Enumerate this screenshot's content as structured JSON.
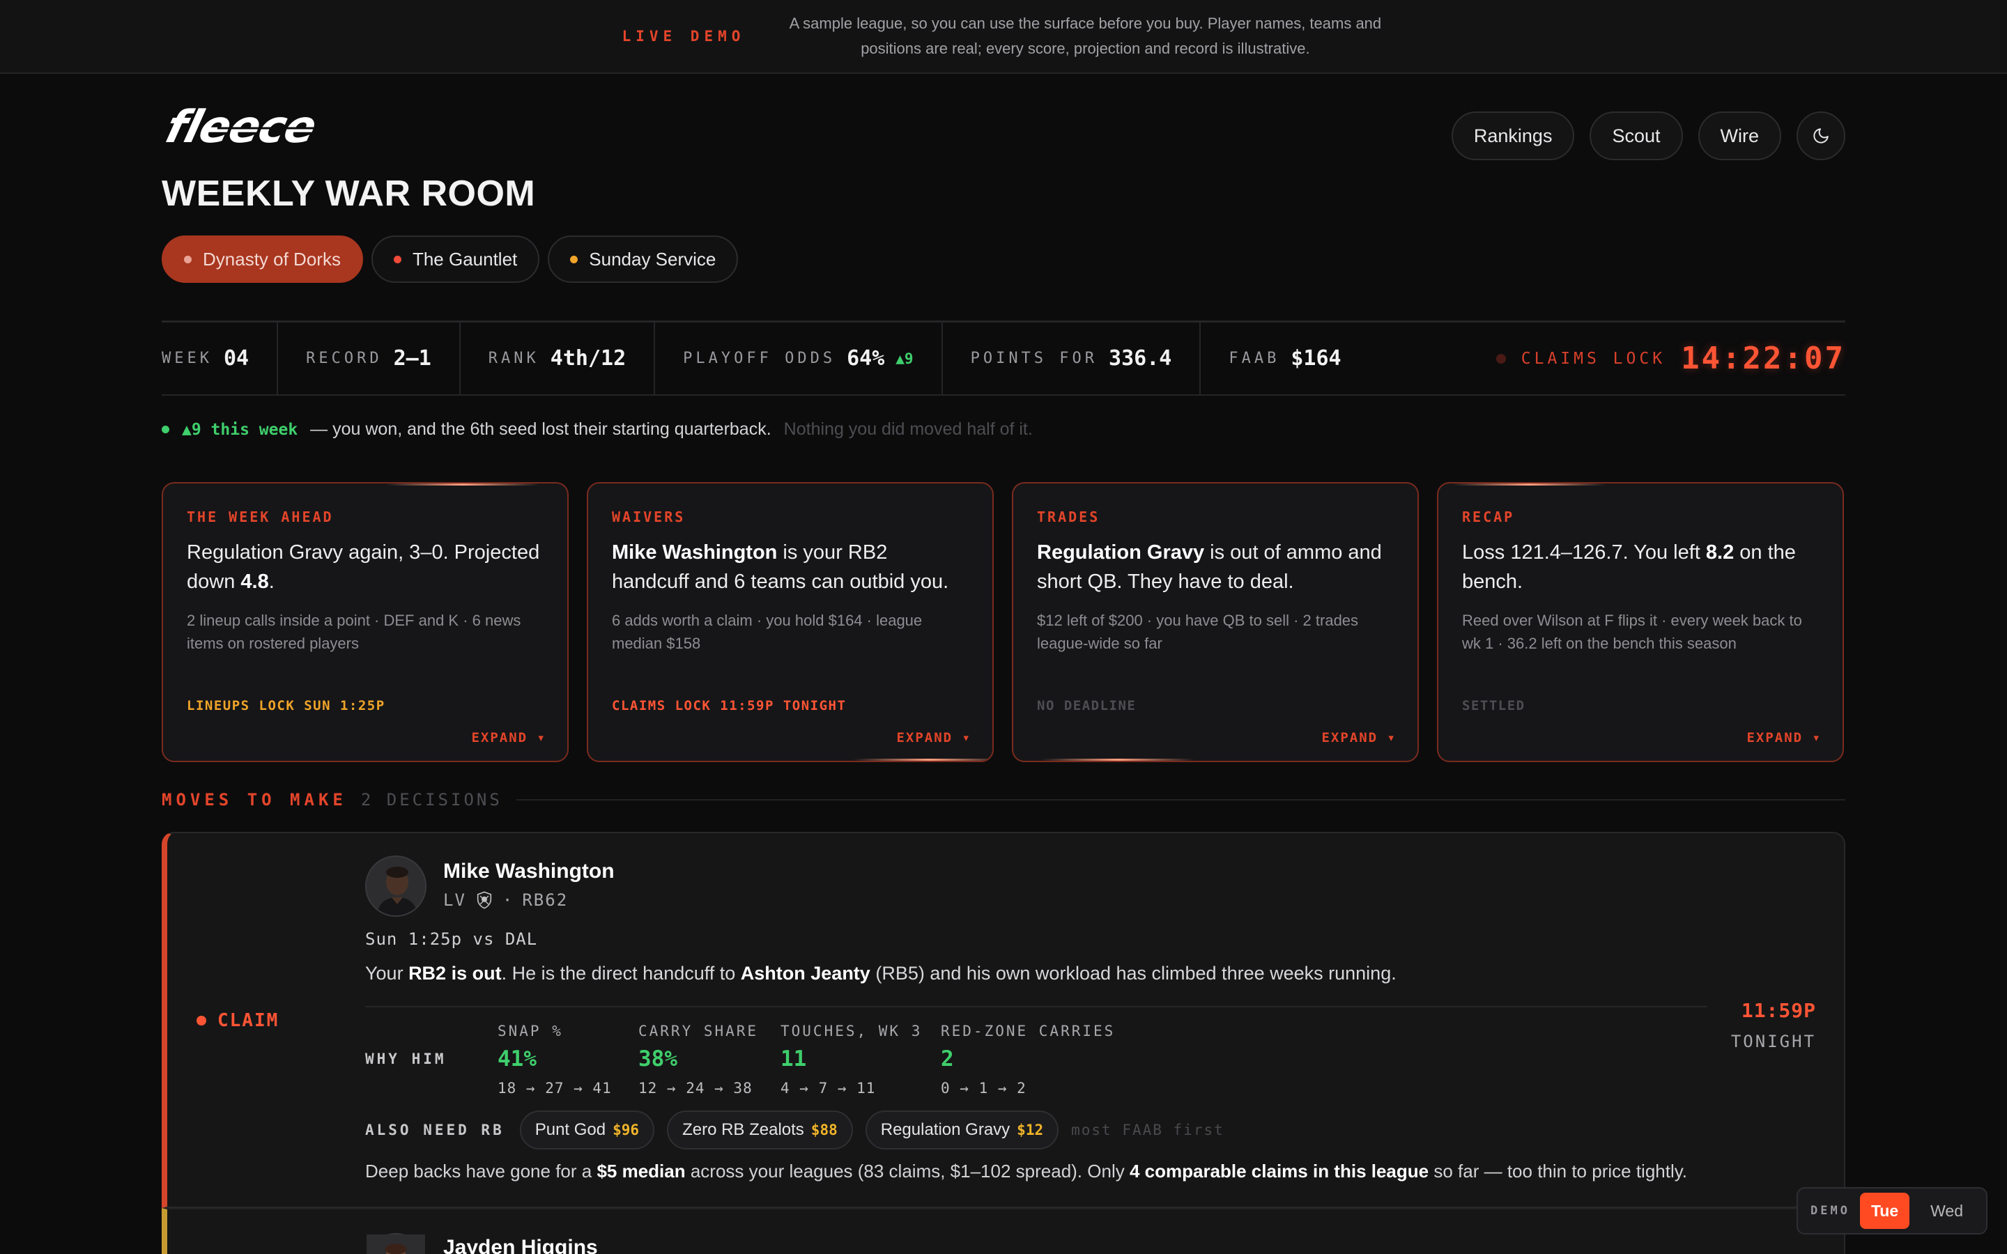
{
  "banner": {
    "tag": "LIVE DEMO",
    "text": "A sample league, so you can use the surface before you buy. Player names, teams and positions are real; every score, projection and record is illustrative."
  },
  "brand": {
    "logo_text": "fleece"
  },
  "nav": {
    "items": [
      "Rankings",
      "Scout",
      "Wire"
    ],
    "theme_icon": "moon-icon"
  },
  "page": {
    "title": "WEEKLY WAR ROOM"
  },
  "leagues": [
    {
      "label": "Dynasty of Dorks",
      "dot_color": "#e9a496",
      "active": true
    },
    {
      "label": "The Gauntlet",
      "dot_color": "#f04a3a",
      "active": false
    },
    {
      "label": "Sunday Service",
      "dot_color": "#f0a429",
      "active": false
    }
  ],
  "stats": {
    "week": {
      "label": "WEEK",
      "value": "04"
    },
    "record": {
      "label": "RECORD",
      "value": "2–1"
    },
    "rank": {
      "label": "RANK",
      "value": "4th/12"
    },
    "playoff": {
      "label": "PLAYOFF ODDS",
      "value": "64%",
      "delta": "▲9"
    },
    "points_for": {
      "label": "POINTS FOR",
      "value": "336.4"
    },
    "faab": {
      "label": "FAAB",
      "value": "$164"
    },
    "claims_lock": {
      "label": "CLAIMS LOCK",
      "timer": "14:22:07"
    }
  },
  "note": {
    "highlight": "▲9 this week",
    "main": "— you won, and the 6th seed lost their starting quarterback.",
    "faint": "Nothing you did moved half of it."
  },
  "cards": [
    {
      "kicker": "THE WEEK AHEAD",
      "head_a": "Regulation Gravy again, 3–0. Projected down ",
      "head_b": "4.8",
      "head_c": ".",
      "sub": "2 lineup calls inside a point · DEF and K · 6 news items on rostered players",
      "deadline": "LINEUPS LOCK SUN 1:25P",
      "deadline_color": "#f0a429",
      "expand": "EXPAND ▾"
    },
    {
      "kicker": "WAIVERS",
      "head_a": "",
      "head_b": "Mike Washington",
      "head_c": " is your RB2 handcuff and 6 teams can outbid you.",
      "sub": "6 adds worth a claim · you hold $164 · league median $158",
      "deadline": "CLAIMS LOCK 11:59P TONIGHT",
      "deadline_color": "#ff5535",
      "expand": "EXPAND ▾"
    },
    {
      "kicker": "TRADES",
      "head_a": "",
      "head_b": "Regulation Gravy",
      "head_c": " is out of ammo and short QB. They have to deal.",
      "sub": "$12 left of $200 · you have QB to sell · 2 trades league-wide so far",
      "deadline": "NO DEADLINE",
      "deadline_color": "#4e4e52",
      "expand": "EXPAND ▾"
    },
    {
      "kicker": "RECAP",
      "head_a": "Loss 121.4–126.7. You left ",
      "head_b": "8.2",
      "head_c": " on the bench.",
      "sub": "Reed over Wilson at F flips it · every week back to wk 1 · 36.2 left on the bench this season",
      "deadline": "SETTLED",
      "deadline_color": "#4e4e52",
      "expand": "EXPAND ▾"
    }
  ],
  "moves": {
    "title": "MOVES TO MAKE",
    "count": "2 DECISIONS",
    "items": [
      {
        "tag": "CLAIM",
        "name": "Mike Washington",
        "team": "LV",
        "team_icon": "raiders-shield-icon",
        "sep": "·",
        "position": "RB62",
        "game": "Sun 1:25p vs DAL",
        "reason": {
          "a": "Your ",
          "b": "RB2 is out",
          "c": ". He is the direct handcuff to ",
          "d": "Ashton Jeanty",
          "e": " (RB5) and his own workload has climbed three weeks running."
        },
        "why_label": "WHY HIM",
        "metrics": [
          {
            "label": "SNAP %",
            "value": "41%",
            "trend": "18 → 27 → 41"
          },
          {
            "label": "CARRY SHARE",
            "value": "38%",
            "trend": "12 → 24 → 38"
          },
          {
            "label": "TOUCHES, WK 3",
            "value": "11",
            "trend": "4 → 7 → 11"
          },
          {
            "label": "RED-ZONE CARRIES",
            "value": "2",
            "trend": "0 → 1 → 2"
          }
        ],
        "deadline_time": "11:59P",
        "deadline_day": "TONIGHT",
        "also_need_label": "ALSO NEED RB",
        "rivals": [
          {
            "name": "Punt God",
            "faab": "$96"
          },
          {
            "name": "Zero RB Zealots",
            "faab": "$88"
          },
          {
            "name": "Regulation Gravy",
            "faab": "$12"
          }
        ],
        "rivals_hint": "most FAAB first",
        "footnote": {
          "a": "Deep backs have gone for a ",
          "b": "$5 median",
          "c": " across your leagues (83 claims, $1–102 spread). Only ",
          "d": "4 comparable claims in this league",
          "e": " so far — too thin to price tightly."
        }
      },
      {
        "name": "Jayden Higgins"
      }
    ]
  },
  "demo": {
    "label": "DEMO",
    "days": [
      "Tue",
      "Wed"
    ],
    "active": "Tue"
  },
  "colors": {
    "accent": "#e4452a",
    "positive": "#3fcf6c",
    "warning": "#f0a429"
  }
}
